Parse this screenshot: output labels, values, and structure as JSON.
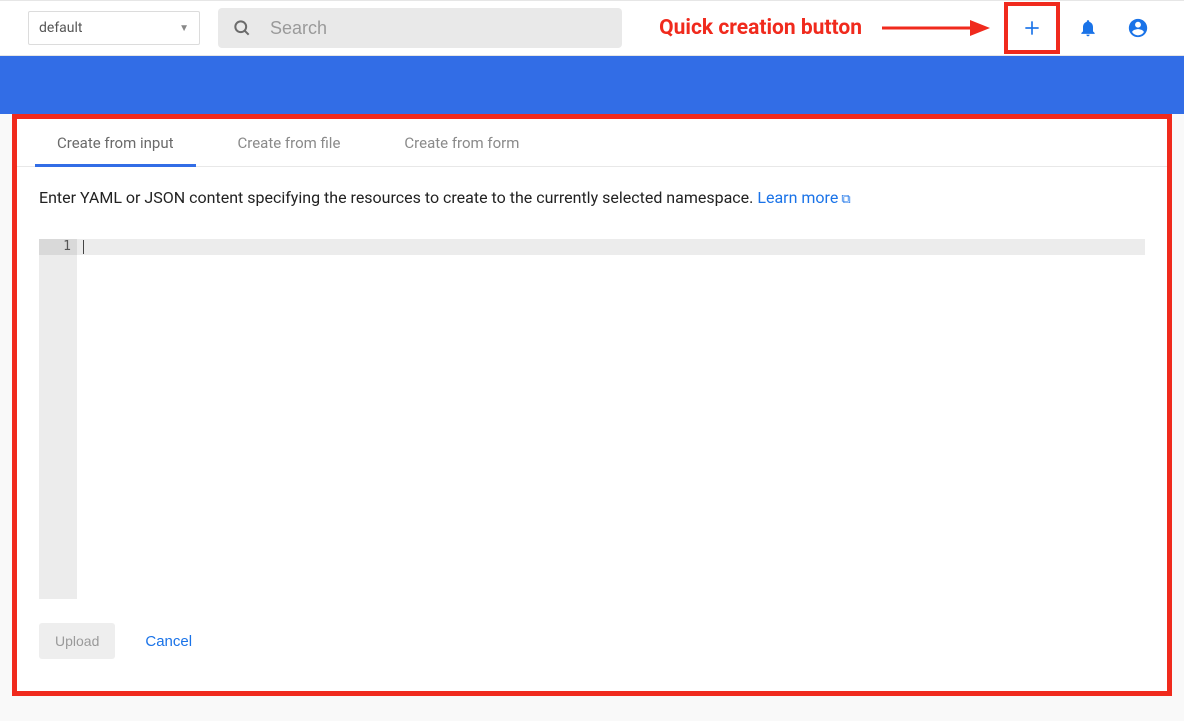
{
  "header": {
    "namespace_selected": "default",
    "search_placeholder": "Search"
  },
  "annotation": {
    "label": "Quick creation button"
  },
  "tabs": [
    {
      "label": "Create from input",
      "active": true
    },
    {
      "label": "Create from file",
      "active": false
    },
    {
      "label": "Create from form",
      "active": false
    }
  ],
  "content": {
    "instruction": "Enter YAML or JSON content specifying the resources to create to the currently selected namespace. ",
    "learn_more": "Learn more"
  },
  "editor": {
    "lines": [
      "1"
    ],
    "content": ""
  },
  "buttons": {
    "upload": "Upload",
    "cancel": "Cancel"
  }
}
